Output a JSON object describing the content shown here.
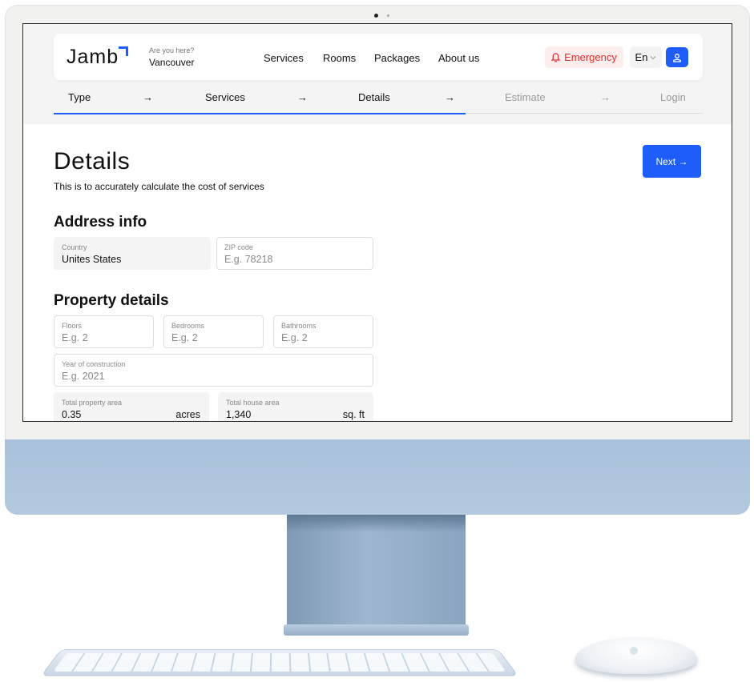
{
  "brand": {
    "logo": "Jamb"
  },
  "location": {
    "hint": "Are you here?",
    "city": "Vancouver"
  },
  "nav": {
    "items": [
      "Services",
      "Rooms",
      "Packages",
      "About us"
    ]
  },
  "header": {
    "emergency_label": "Emergency",
    "language": "En",
    "emergency_icon": "bell-icon",
    "user_icon": "user-icon"
  },
  "steps": {
    "items": [
      "Type",
      "Services",
      "Details",
      "Estimate",
      "Login"
    ],
    "arrow": "→",
    "active_index": 2
  },
  "page": {
    "title": "Details",
    "subtitle": "This is to accurately calculate the cost of services",
    "next_label": "Next →"
  },
  "address": {
    "title": "Address info",
    "country": {
      "label": "Country",
      "value": "Unites States"
    },
    "zip": {
      "label": "ZIP code",
      "placeholder": "E.g. 78218"
    }
  },
  "property": {
    "title": "Property details",
    "floors": {
      "label": "Floors",
      "placeholder": "E.g. 2"
    },
    "bedrooms": {
      "label": "Bedrooms",
      "placeholder": "E.g. 2"
    },
    "bathrooms": {
      "label": "Bathrooms",
      "placeholder": "E.g. 2"
    },
    "year": {
      "label": "Year of construction",
      "placeholder": "E.g. 2021"
    },
    "total_area": {
      "label": "Total property area",
      "value": "0.35",
      "unit": "acres"
    },
    "house_area": {
      "label": "Total house area",
      "value": "1,340",
      "unit": "sq. ft"
    }
  },
  "colors": {
    "accent": "#1e5dfa",
    "emergency": "#e02d2d",
    "device": "#a9c1da"
  }
}
